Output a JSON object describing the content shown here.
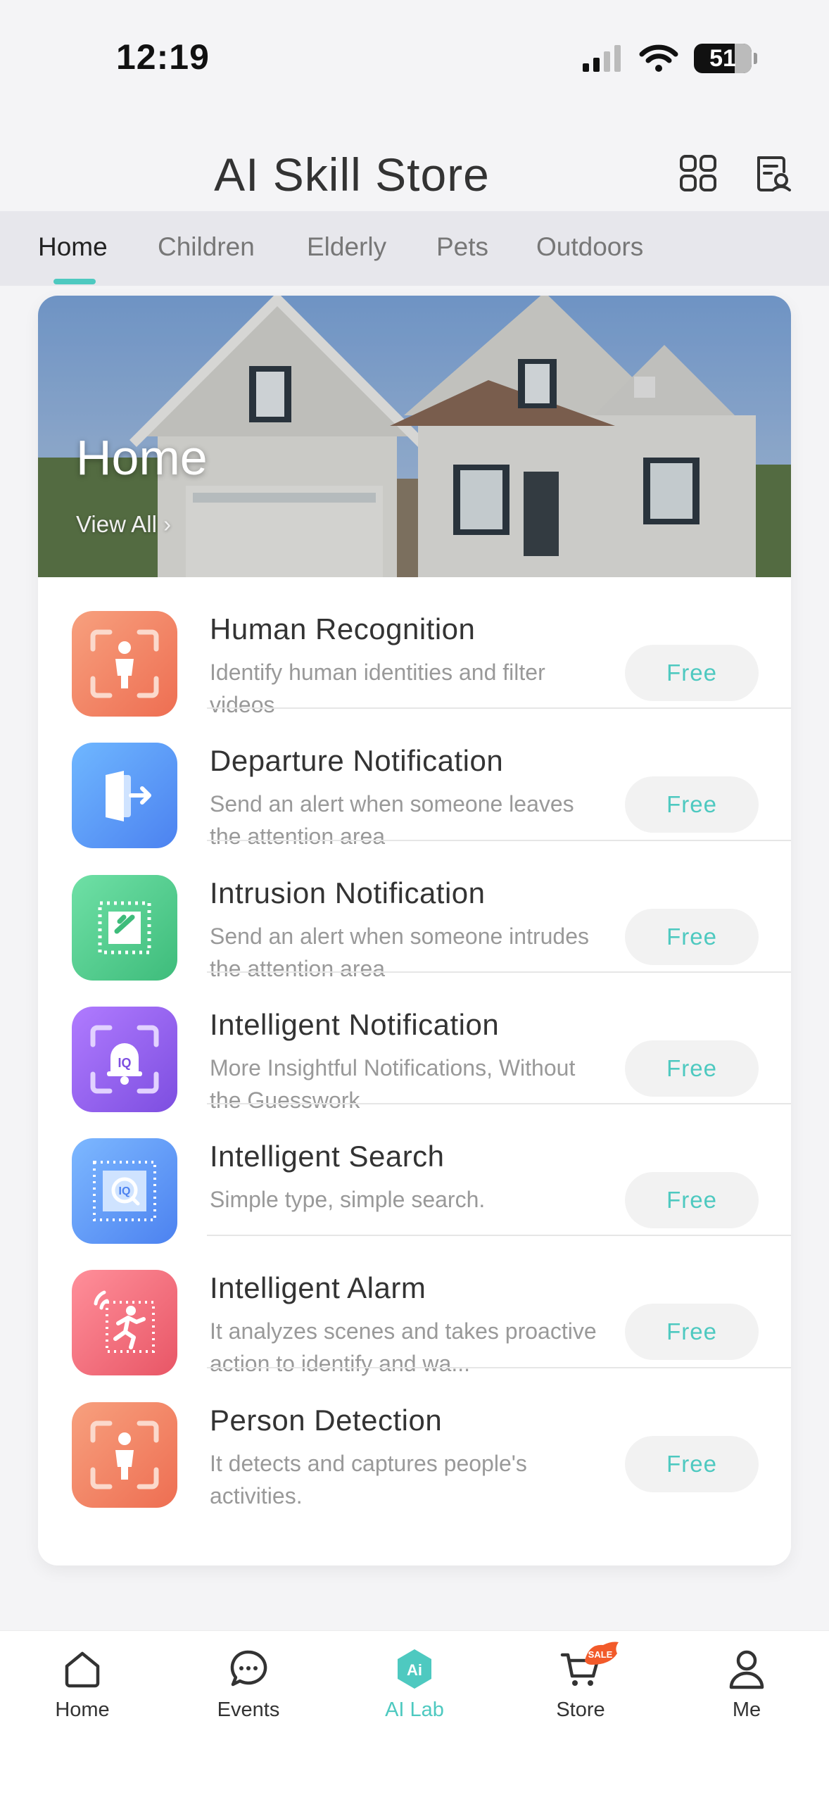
{
  "status_bar": {
    "time": "12:19",
    "battery": "51"
  },
  "header": {
    "title": "AI Skill Store",
    "grid_icon": "grid-icon",
    "doc_icon": "document-search-icon"
  },
  "tabs": [
    {
      "label": "Home",
      "active": true
    },
    {
      "label": "Children",
      "active": false
    },
    {
      "label": "Elderly",
      "active": false
    },
    {
      "label": "Pets",
      "active": false
    },
    {
      "label": "Outdoors",
      "active": false
    }
  ],
  "hero": {
    "title": "Home",
    "link_label": "View All"
  },
  "skills": [
    {
      "title": "Human Recognition",
      "description": "Identify human identities and filter videos",
      "button": "Free",
      "icon": "human-recognition-icon",
      "color_from": "#f7a07e",
      "color_to": "#ee6e52"
    },
    {
      "title": "Departure Notification",
      "description": "Send an alert when someone leaves the attention area",
      "button": "Free",
      "icon": "departure-icon",
      "color_from": "#6fb7ff",
      "color_to": "#4c82f0"
    },
    {
      "title": "Intrusion Notification",
      "description": "Send an alert when someone intrudes the attention area",
      "button": "Free",
      "icon": "intrusion-icon",
      "color_from": "#6fe0a6",
      "color_to": "#3ebc7b"
    },
    {
      "title": "Intelligent Notification",
      "description": "More Insightful Notifications, Without the Guesswork",
      "button": "Free",
      "icon": "bell-icon",
      "color_from": "#b07bff",
      "color_to": "#7d4ee0"
    },
    {
      "title": "Intelligent Search",
      "description": "Simple type, simple search.",
      "button": "Free",
      "icon": "search-iq-icon",
      "color_from": "#7db8ff",
      "color_to": "#4c82f0"
    },
    {
      "title": "Intelligent Alarm",
      "description": "It analyzes scenes and takes proactive action to identify and wa...",
      "button": "Free",
      "icon": "alarm-running-icon",
      "color_from": "#ff8f9a",
      "color_to": "#e85666"
    },
    {
      "title": "Person Detection",
      "description": "It detects and captures people's activities.",
      "button": "Free",
      "icon": "person-detection-icon",
      "color_from": "#f7a07e",
      "color_to": "#ee6e52"
    }
  ],
  "bottom_nav": [
    {
      "label": "Home",
      "icon": "home-icon",
      "active": false
    },
    {
      "label": "Events",
      "icon": "chat-icon",
      "active": false
    },
    {
      "label": "AI Lab",
      "icon": "ai-icon",
      "active": true
    },
    {
      "label": "Store",
      "icon": "cart-icon",
      "active": false,
      "badge": "SALE"
    },
    {
      "label": "Me",
      "icon": "person-icon",
      "active": false
    }
  ],
  "colors": {
    "accent": "#4ec9c0",
    "sale": "#f25a2a"
  }
}
